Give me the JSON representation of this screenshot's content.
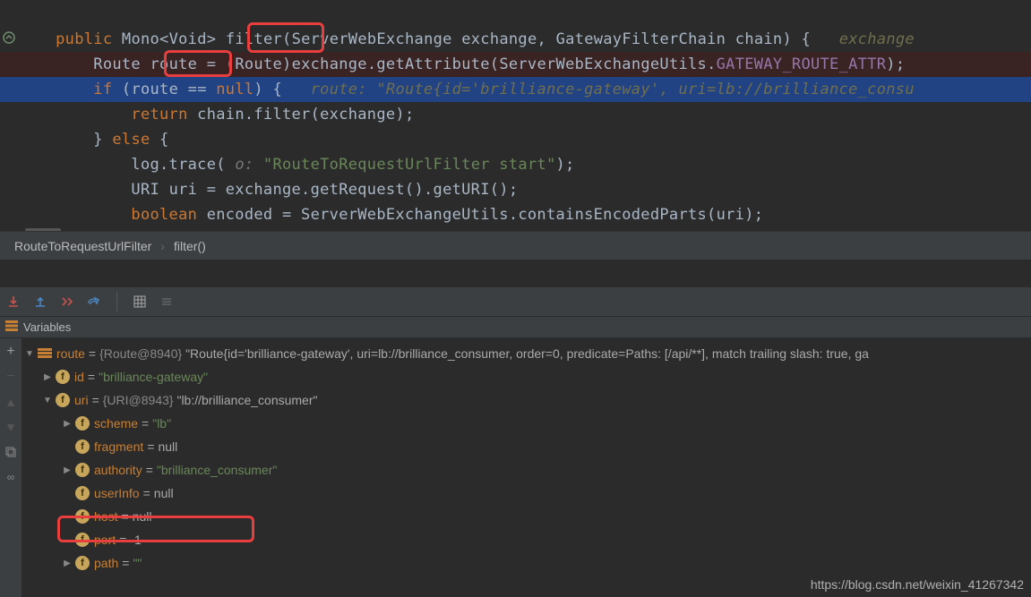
{
  "code": {
    "line1": {
      "kw_public": "public",
      "type_mono": "Mono",
      "type_void": "Void",
      "method": "filter",
      "paren_open": "(",
      "p1_type": "ServerWebExchange",
      "p1_name": "exchange",
      "comma": ",",
      "p2_type": "GatewayFilterChain",
      "p2_name": "chain",
      "paren_close_brace": ") {",
      "inlay": "exchange"
    },
    "line2": {
      "type_route": "Route",
      "var_route": "route",
      "eq": " = ",
      "cast": "(Route)",
      "expr": "exchange.getAttribute(ServerWebExchangeUtils.",
      "const": "GATEWAY_ROUTE_ATTR",
      "end": ");"
    },
    "line3": {
      "kw_if": "if",
      "open": " (",
      "var": "route",
      "op": " == ",
      "kw_null": "null",
      "close": ") {",
      "inlay": "route: \"Route{id='brilliance-gateway', uri=lb://brilliance_consu"
    },
    "line4": {
      "kw_return": "return",
      "expr": " chain.filter(exchange);"
    },
    "line5": {
      "close": "}",
      "kw_else": "else",
      "open": " {"
    },
    "line6": {
      "expr_a": "log.trace(",
      "hint": " o: ",
      "str": "\"RouteToRequestUrlFilter start\"",
      "expr_b": ");"
    },
    "line7": {
      "type": "URI",
      "var": " uri = exchange.getRequest().getURI();"
    },
    "line8": {
      "kw_bool": "boolean",
      "var": " encoded = ServerWebExchangeUtils.containsEncodedParts(uri);"
    }
  },
  "breadcrumb": {
    "class": "RouteToRequestUrlFilter",
    "method": "filter()"
  },
  "vars_label": "Variables",
  "tree": {
    "root_name": "route",
    "root_gray": "{Route@8940}",
    "root_val": "\"Route{id='brilliance-gateway', uri=lb://brilliance_consumer, order=0, predicate=Paths: [/api/**], match trailing slash: true, ga",
    "id_name": "id",
    "id_val": "\"brilliance-gateway\"",
    "uri_name": "uri",
    "uri_gray": "{URI@8943}",
    "uri_val": "\"lb://brilliance_consumer\"",
    "scheme_name": "scheme",
    "scheme_val": "\"lb\"",
    "fragment_name": "fragment",
    "fragment_val": "null",
    "authority_name": "authority",
    "authority_val": "\"brilliance_consumer\"",
    "userInfo_name": "userInfo",
    "userInfo_val": "null",
    "host_name": "host",
    "host_val": "null",
    "port_name": "port",
    "port_val": "-1",
    "path_name": "path",
    "path_val": "\"\""
  },
  "watermark": "https://blog.csdn.net/weixin_41267342"
}
